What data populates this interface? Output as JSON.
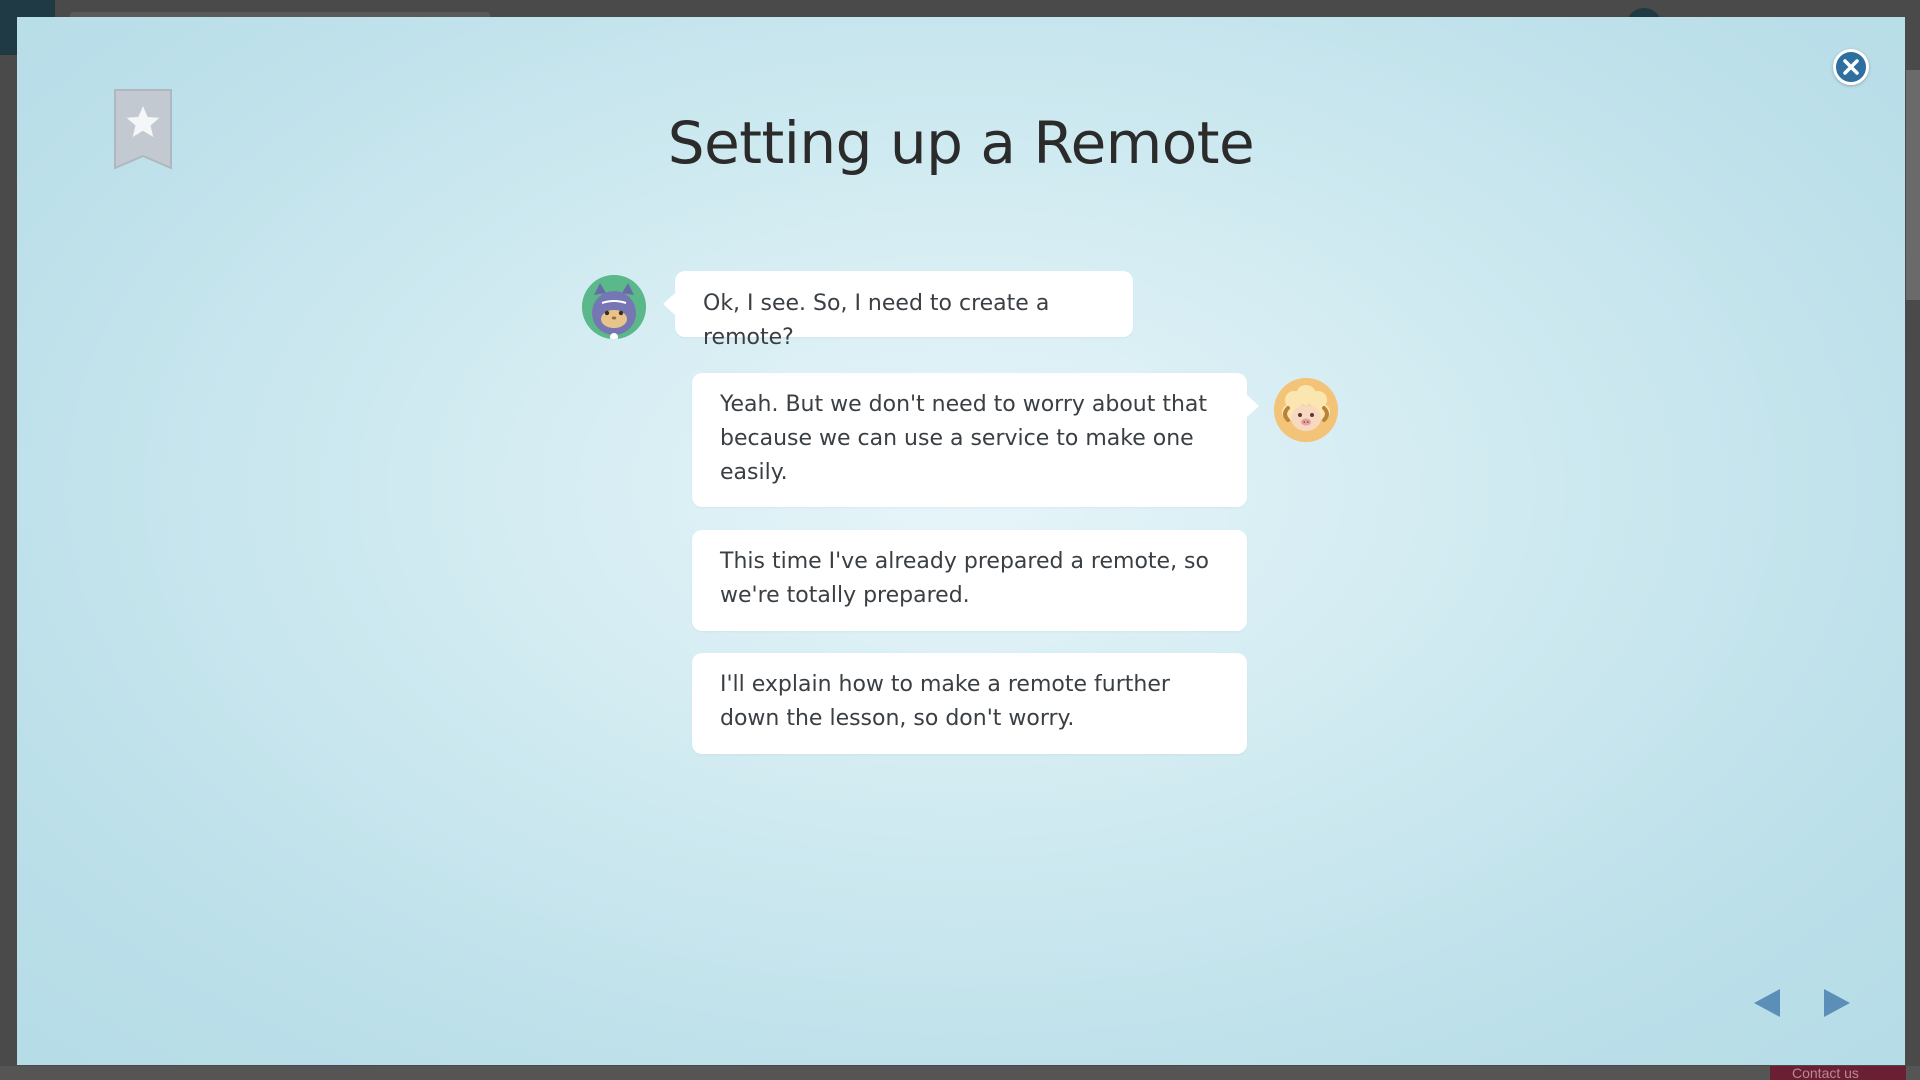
{
  "modal": {
    "title": "Setting up a Remote"
  },
  "background": {
    "contact_label": "Contact us"
  },
  "messages": [
    {
      "speaker": "cat",
      "text": "Ok, I see. So, I need to create a remote?"
    },
    {
      "speaker": "sheep",
      "text": "Yeah. But we don't need to worry about that because we can use a service to make one easily."
    },
    {
      "speaker": "sheep",
      "text": "This time I've already prepared a remote, so we're totally prepared."
    },
    {
      "speaker": "sheep",
      "text": "I'll explain how to make a remote further down the lesson, so don't worry."
    }
  ],
  "icons": {
    "bookmark": "bookmark-star-icon",
    "close": "close-icon",
    "prev": "prev-arrow-icon",
    "next": "next-arrow-icon"
  },
  "colors": {
    "accent": "#2f6fa0",
    "nav_arrow": "#5b8fb8",
    "bookmark": "#c3c9d1",
    "cat_avatar_bg": "#5ab88a",
    "sheep_avatar_bg": "#f5c77a"
  }
}
